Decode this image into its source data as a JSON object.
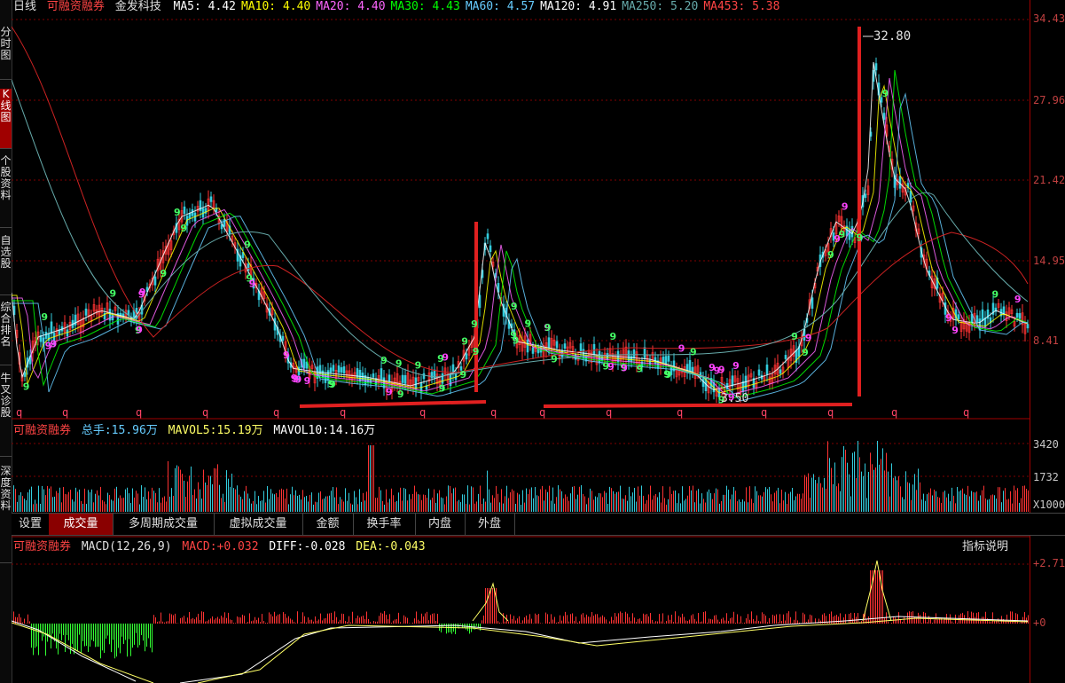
{
  "sidebar": {
    "tabs": [
      {
        "label": "分时图",
        "active": false
      },
      {
        "label": "K线图",
        "active": true
      },
      {
        "label": "个股资料",
        "active": false
      },
      {
        "label": "自选股",
        "active": false
      },
      {
        "label": "综合排名",
        "active": false
      },
      {
        "label": "牛叉诊股",
        "active": false
      },
      {
        "label": "深度资料",
        "active": false
      }
    ]
  },
  "kline_header": {
    "period": "日线",
    "margin_tag": "可融资融券",
    "stock_name": "金发科技",
    "ma": [
      {
        "label": "MA5",
        "value": "4.42",
        "color": "#ffffff"
      },
      {
        "label": "MA10",
        "value": "4.40",
        "color": "#ffff00"
      },
      {
        "label": "MA20",
        "value": "4.40",
        "color": "#ff66ff"
      },
      {
        "label": "MA30",
        "value": "4.43",
        "color": "#00ff00"
      },
      {
        "label": "MA60",
        "value": "4.57",
        "color": "#66ccff"
      },
      {
        "label": "MA120",
        "value": "4.91",
        "color": "#ffffff"
      },
      {
        "label": "MA250",
        "value": "5.20",
        "color": "#66aaaa"
      },
      {
        "label": "MA453",
        "value": "5.38",
        "color": "#ff4444"
      }
    ]
  },
  "price_axis": {
    "ticks": [
      "34.43",
      "27.96",
      "21.42",
      "14.95",
      "8.41"
    ]
  },
  "annotations": {
    "high": "32.80",
    "low": "3.50"
  },
  "q_markers": [
    "q",
    "q",
    "q",
    "q",
    "q",
    "q",
    "q",
    "q",
    "q",
    "q",
    "q",
    "q",
    "q",
    "q",
    "q",
    "q",
    "q",
    "q"
  ],
  "volume_header": {
    "margin_tag": "可融资融券",
    "total_label": "总手:",
    "total_value": "15.96万",
    "vol5_label": "MAVOL5:",
    "vol5_value": "15.19万",
    "vol10_label": "MAVOL10:",
    "vol10_value": "14.16万"
  },
  "volume_axis": {
    "ticks": [
      "3420",
      "1732"
    ],
    "unit": "X1000"
  },
  "volume_tabs": [
    {
      "label": "设置",
      "active": false
    },
    {
      "label": "成交量",
      "active": true
    },
    {
      "label": "多周期成交量",
      "active": false
    },
    {
      "label": "虚拟成交量",
      "active": false
    },
    {
      "label": "金额",
      "active": false
    },
    {
      "label": "换手率",
      "active": false
    },
    {
      "label": "内盘",
      "active": false
    },
    {
      "label": "外盘",
      "active": false
    }
  ],
  "macd_header": {
    "margin_tag": "可融资融券",
    "name": "MACD(12,26,9)",
    "macd_label": "MACD:",
    "macd_value": "+0.032",
    "diff_label": "DIFF:",
    "diff_value": "-0.028",
    "dea_label": "DEA:",
    "dea_value": "-0.043",
    "help": "指标说明"
  },
  "macd_axis": {
    "ticks": [
      "+2.71",
      "+0"
    ]
  },
  "colors": {
    "up": "#ff3333",
    "down": "#33ccdd",
    "macd_neg": "#33ff33",
    "grid": "#800000",
    "annotation": "#e02020"
  }
}
